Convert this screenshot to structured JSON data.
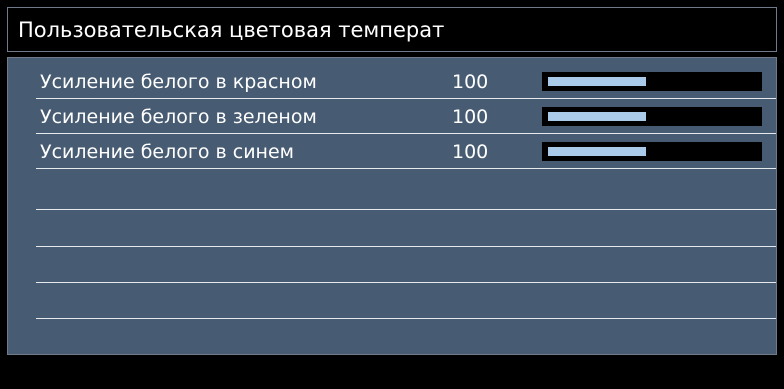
{
  "menu": {
    "title": "Пользовательская цветовая температ"
  },
  "rows": [
    {
      "label": "Усиление белого в красном",
      "value": "100",
      "level": 0.47
    },
    {
      "label": "Усиление белого в зеленом",
      "value": "100",
      "level": 0.47
    },
    {
      "label": "Усиление белого в синем",
      "value": "100",
      "level": 0.47
    }
  ],
  "colors": {
    "panel_background": "#475b72",
    "slider_fill": "#a9cbe9",
    "slider_track": "#000000",
    "text": "#ffffff"
  }
}
